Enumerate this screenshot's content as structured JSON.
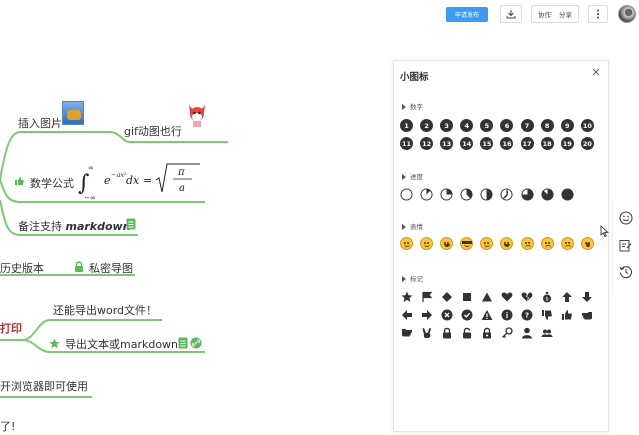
{
  "toolbar": {
    "publish_label": "申请发布",
    "cooperate_label": "协作",
    "share_label": "分享"
  },
  "mindmap": {
    "insert_image": "插入图片",
    "gif_support": "gif动图也行",
    "math_formula": "数学公式",
    "notes_support_prefix": "备注支持 ",
    "notes_support_em": "markdown",
    "history": "历史版本",
    "private_map": "私密导图",
    "export_word": "还能导出word文件！",
    "print": "打印",
    "export_text": "导出文本或markdown",
    "browser_use": "开浏览器即可使用",
    "bottom_text": "了!"
  },
  "panel": {
    "title": "小图标",
    "sections": {
      "numbers": "数字",
      "progress": "进度",
      "emotion": "表情",
      "marks": "标记"
    },
    "numbers_row1": [
      "1",
      "2",
      "3",
      "4",
      "5",
      "6",
      "7",
      "8",
      "9",
      "10"
    ],
    "numbers_row2": [
      "11",
      "12",
      "13",
      "14",
      "15",
      "16",
      "17",
      "18",
      "19",
      "20"
    ]
  },
  "colors": {
    "accent": "#3b9cf2",
    "branch": "#7ec876",
    "icon_dark": "#333333"
  }
}
